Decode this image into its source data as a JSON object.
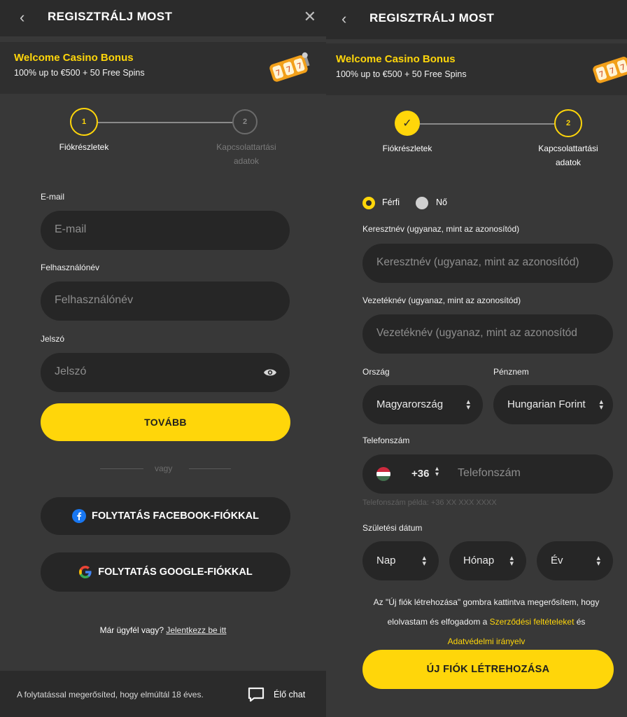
{
  "left": {
    "header": {
      "title": "REGISZTRÁLJ MOST",
      "back_icon": "‹",
      "close_icon": "✕"
    },
    "bonus": {
      "title": "Welcome Casino Bonus",
      "subtitle": "100% up to €500 + 50 Free Spins"
    },
    "steps": [
      {
        "num": "1",
        "label": "Fiókrészletek"
      },
      {
        "num": "2",
        "label_line1": "Kapcsolattartási",
        "label_line2": "adatok"
      }
    ],
    "form": {
      "email": {
        "label": "E-mail",
        "placeholder": "E-mail"
      },
      "username": {
        "label": "Felhasználónév",
        "placeholder": "Felhasználónév"
      },
      "password": {
        "label": "Jelszó",
        "placeholder": "Jelszó"
      },
      "next_button": "TOVÁBB",
      "or_text": "vagy",
      "facebook_button": "FOLYTATÁS FACEBOOK-FIÓKKAL",
      "google_button": "FOLYTATÁS GOOGLE-FIÓKKAL"
    },
    "login": {
      "question": "Már ügyfél vagy?",
      "link": "Jelentkezz be itt"
    },
    "footer": {
      "text": "A folytatással megerősíted, hogy elmúltál 18 éves.",
      "chat_label": "Élő chat"
    }
  },
  "right": {
    "header": {
      "title": "REGISZTRÁLJ MOST",
      "back_icon": "‹"
    },
    "bonus": {
      "title": "Welcome Casino Bonus",
      "subtitle": "100% up to €500 + 50 Free Spins"
    },
    "steps": [
      {
        "num": "✓",
        "label": "Fiókrészletek"
      },
      {
        "num": "2",
        "label_line1": "Kapcsolattartási",
        "label_line2": "adatok"
      }
    ],
    "gender": {
      "male": "Férfi",
      "female": "Nő",
      "selected": "male"
    },
    "first_name": {
      "label": "Keresztnév (ugyanaz, mint az azonosítód)",
      "placeholder": "Keresztnév (ugyanaz, mint az azonosítód)"
    },
    "last_name": {
      "label": "Vezetéknév (ugyanaz, mint az azonosítód)",
      "placeholder": "Vezetéknév (ugyanaz, mint az azonosítód"
    },
    "country": {
      "label": "Ország",
      "value": "Magyarország"
    },
    "currency": {
      "label": "Pénznem",
      "value": "Hungarian Forint"
    },
    "phone": {
      "label": "Telefonszám",
      "code": "+36",
      "placeholder": "Telefonszám",
      "hint": "Telefonszám példa: +36 XX XXX XXXX"
    },
    "birth": {
      "label": "Születési dátum",
      "day": "Nap",
      "month": "Hónap",
      "year": "Év"
    },
    "terms": {
      "line1": "Az \"Új fiók létrehozása\" gombra kattintva megerősítem, hogy",
      "line2_prefix": "elolvastam és elfogadom a ",
      "terms_link": "Szerződési feltételeket",
      "line2_suffix": " és",
      "privacy_link": "Adatvédelmi irányelv"
    },
    "create_button": "ÚJ FIÓK LÉTREHOZÁSA"
  }
}
